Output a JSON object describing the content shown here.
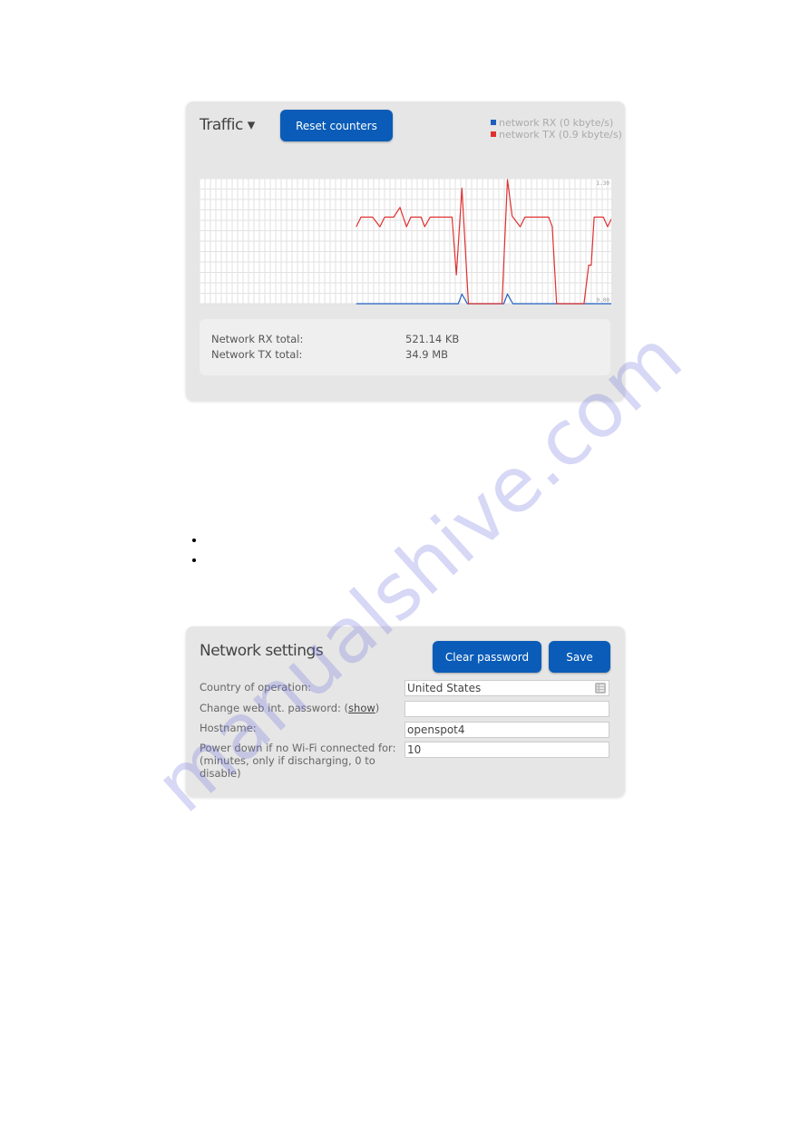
{
  "traffic": {
    "title": "Traffic ▾",
    "reset_label": "Reset counters",
    "legend": [
      {
        "label": "network RX (0 kbyte/s)",
        "color": "#1f5fbf"
      },
      {
        "label": "network TX (0.9 kbyte/s)",
        "color": "#e03030"
      }
    ],
    "totals": [
      {
        "label": "Network RX total:",
        "value": "521.14 KB"
      },
      {
        "label": "Network TX total:",
        "value": "34.9 MB"
      }
    ]
  },
  "chart_data": {
    "type": "line",
    "ylim": [
      0,
      1.3
    ],
    "xlim": [
      0,
      113
    ],
    "grid": true,
    "y_tick_labels": [
      "1.30",
      "0.00"
    ],
    "series": [
      {
        "color": "#1f5fbf",
        "points": [
          [
            43,
            0
          ],
          [
            71,
            0
          ],
          [
            72,
            0.1
          ],
          [
            73.5,
            0
          ],
          [
            83.5,
            0
          ],
          [
            84.5,
            0.1
          ],
          [
            86,
            0
          ],
          [
            113,
            0
          ]
        ]
      },
      {
        "color": "#e03030",
        "points": [
          [
            43,
            0.8
          ],
          [
            44.3,
            0.9
          ],
          [
            47.5,
            0.9
          ],
          [
            49.5,
            0.8
          ],
          [
            50.8,
            0.9
          ],
          [
            53.3,
            0.9
          ],
          [
            55,
            1.0
          ],
          [
            56.8,
            0.8
          ],
          [
            58,
            0.9
          ],
          [
            60.8,
            0.9
          ],
          [
            61.8,
            0.8
          ],
          [
            63.3,
            0.9
          ],
          [
            69.3,
            0.9
          ],
          [
            70.5,
            0.3
          ],
          [
            72,
            1.2
          ],
          [
            73.8,
            0
          ],
          [
            83,
            0
          ],
          [
            84.5,
            1.29
          ],
          [
            85.8,
            0.91
          ],
          [
            88,
            0.8
          ],
          [
            89.3,
            0.9
          ],
          [
            95.8,
            0.9
          ],
          [
            96.8,
            0.8
          ],
          [
            98,
            0
          ],
          [
            105.5,
            0
          ],
          [
            106.8,
            0.4
          ],
          [
            107.5,
            0.4
          ],
          [
            108.3,
            0.9
          ],
          [
            110.8,
            0.9
          ],
          [
            112,
            0.8
          ],
          [
            113,
            0.88
          ]
        ]
      }
    ]
  },
  "network_settings": {
    "title": "Network settings",
    "clear_password_label": "Clear password",
    "save_label": "Save",
    "fields": [
      {
        "label": "Country of operation:",
        "value": "United States"
      },
      {
        "label_prefix": "Change web int. password: (",
        "label_link": "show",
        "label_suffix": ")",
        "value": ""
      },
      {
        "label": "Hostname:",
        "value": "openspot4"
      },
      {
        "label": "Power down if no Wi-Fi connected for: (minutes, only if discharging, 0 to disable)",
        "value": "10"
      }
    ]
  },
  "watermark": "manualshive.com"
}
